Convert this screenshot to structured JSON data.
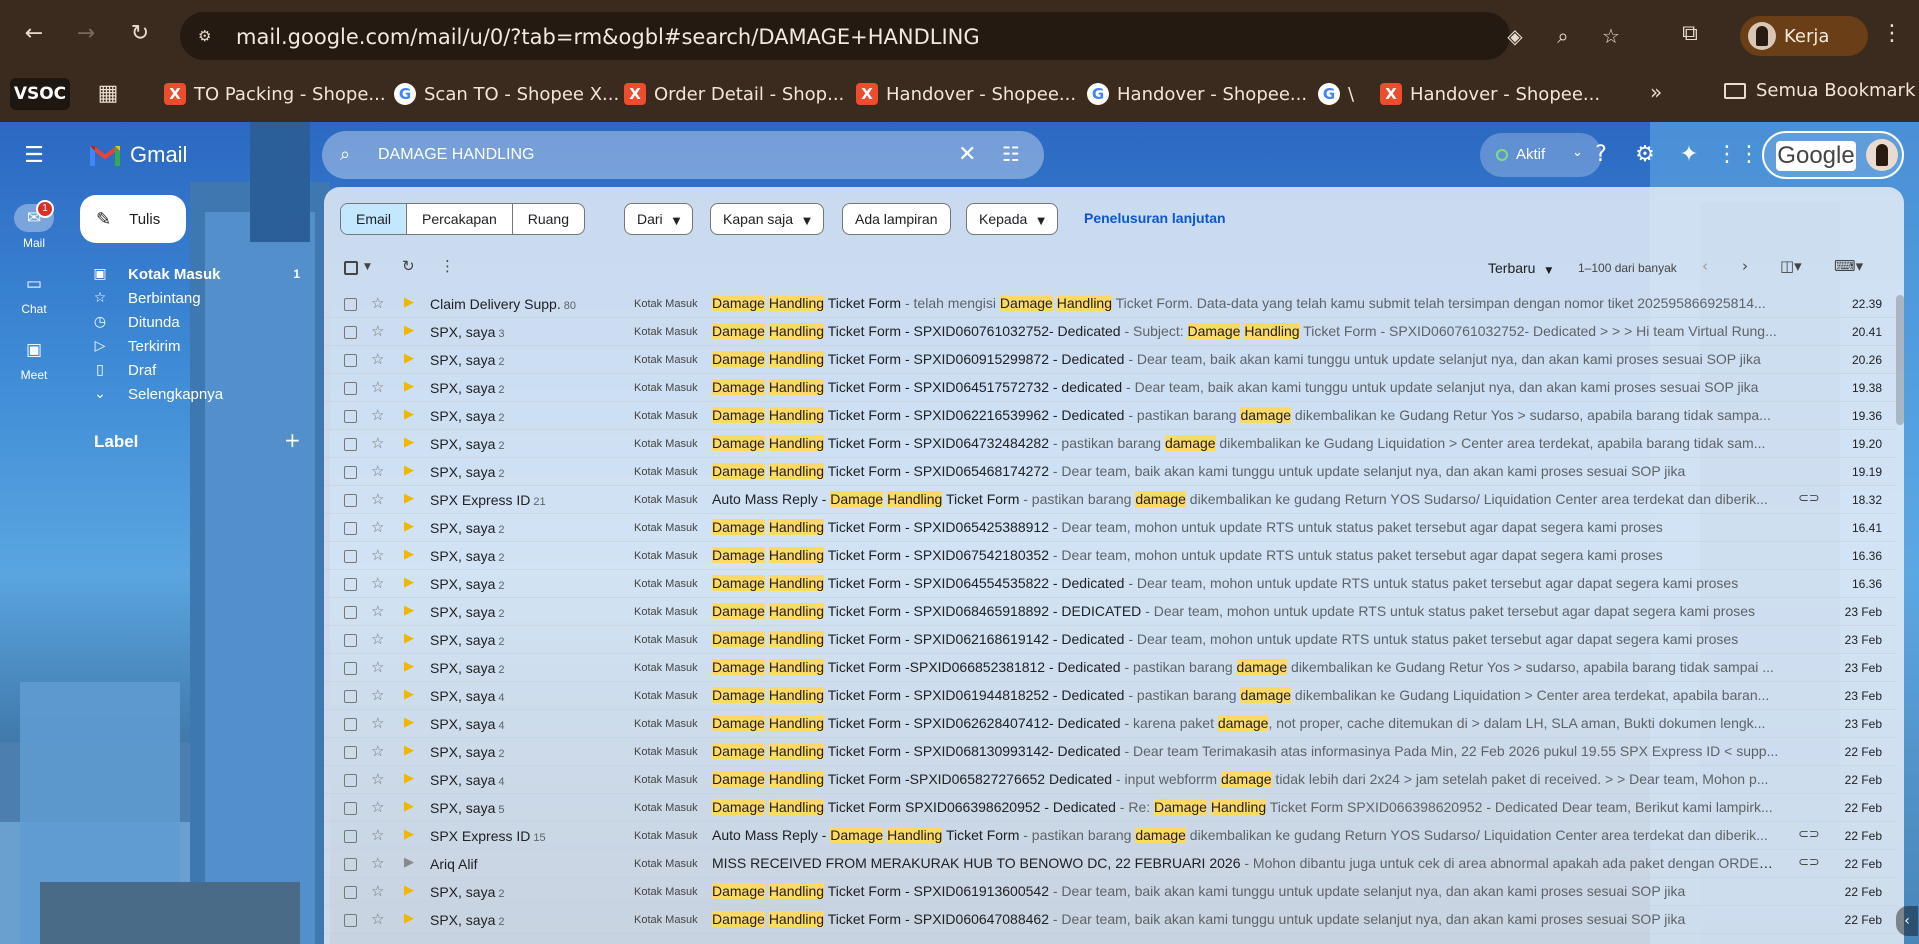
{
  "browser": {
    "url": "mail.google.com/mail/u/0/?tab=rm&ogbl#search/DAMAGE+HANDLING",
    "profile_name": "Kerja",
    "bookmarks": [
      {
        "label": "TO Packing - Shope...",
        "icon": "x"
      },
      {
        "label": "Scan TO - Shopee X...",
        "icon": "g"
      },
      {
        "label": "Order Detail - Shop...",
        "icon": "x"
      },
      {
        "label": "Handover - Shopee...",
        "icon": "x"
      },
      {
        "label": "Handover - Shopee...",
        "icon": "g"
      },
      {
        "label": "\\",
        "icon": "g"
      },
      {
        "label": "Handover - Shopee...",
        "icon": "x"
      }
    ],
    "vsoc_label": "VSOC",
    "bookmarks_folder": "Semua Bookmark"
  },
  "gmail": {
    "logo_text": "Gmail",
    "search_value": "DAMAGE HANDLING",
    "status_label": "Aktif",
    "account_logo_text": "Google",
    "rail": {
      "mail": "Mail",
      "mail_badge": "1",
      "chat": "Chat",
      "meet": "Meet"
    },
    "compose_label": "Tulis",
    "nav": [
      {
        "label": "Kotak Masuk",
        "count": "1",
        "icon": "inbox-icon"
      },
      {
        "label": "Berbintang",
        "count": "",
        "icon": "star-icon"
      },
      {
        "label": "Ditunda",
        "count": "",
        "icon": "clock-icon"
      },
      {
        "label": "Terkirim",
        "count": "",
        "icon": "send-icon"
      },
      {
        "label": "Draf",
        "count": "",
        "icon": "draft-icon"
      },
      {
        "label": "Selengkapnya",
        "count": "",
        "icon": "chevron-down-icon"
      }
    ],
    "labels_heading": "Label",
    "scope_tabs": [
      "Email",
      "Percakapan",
      "Ruang"
    ],
    "filters": {
      "from": "Dari",
      "time": "Kapan saja",
      "attachment": "Ada lampiran",
      "to": "Kepada",
      "advanced": "Penelusuran lanjutan"
    },
    "sort_label": "Terbaru",
    "range_text": "1–100 dari banyak",
    "inbox_tag": "Kotak Masuk",
    "emails": [
      {
        "sender": "Claim Delivery Supp.",
        "count": "80",
        "important": true,
        "subject_parts": [
          [
            "Damage",
            1
          ],
          [
            " ",
            0
          ],
          [
            "Handling",
            1
          ],
          [
            " Ticket Form",
            0
          ]
        ],
        "snippet_parts": [
          [
            " - telah mengisi ",
            0
          ],
          [
            "Damage",
            1
          ],
          [
            " ",
            0
          ],
          [
            "Handling",
            1
          ],
          [
            " Ticket Form. Data-data yang telah kamu submit telah tersimpan dengan nomor tiket 202595866925814...",
            0
          ]
        ],
        "attachment": false,
        "date": "22.39"
      },
      {
        "sender": "SPX, saya",
        "count": "3",
        "important": true,
        "subject_parts": [
          [
            "Damage",
            1
          ],
          [
            " ",
            0
          ],
          [
            "Handling",
            1
          ],
          [
            " Ticket Form - SPXID060761032752- Dedicated",
            0
          ]
        ],
        "snippet_parts": [
          [
            " - Subject: ",
            0
          ],
          [
            "Damage",
            1
          ],
          [
            " ",
            0
          ],
          [
            "Handling",
            1
          ],
          [
            " Ticket Form - SPXID060761032752- Dedicated > > > Hi team Virtual Rung...",
            0
          ]
        ],
        "attachment": false,
        "date": "20.41"
      },
      {
        "sender": "SPX, saya",
        "count": "2",
        "important": true,
        "subject_parts": [
          [
            "Damage",
            1
          ],
          [
            " ",
            0
          ],
          [
            "Handling",
            1
          ],
          [
            " Ticket Form - SPXID060915299872 - Dedicated",
            0
          ]
        ],
        "snippet_parts": [
          [
            " - Dear team, baik akan kami tunggu untuk update selanjut nya, dan akan kami proses sesuai SOP jika",
            0
          ]
        ],
        "attachment": false,
        "date": "20.26"
      },
      {
        "sender": "SPX, saya",
        "count": "2",
        "important": true,
        "subject_parts": [
          [
            "Damage",
            1
          ],
          [
            " ",
            0
          ],
          [
            "Handling",
            1
          ],
          [
            " Ticket Form - SPXID064517572732 - dedicated",
            0
          ]
        ],
        "snippet_parts": [
          [
            " - Dear team, baik akan kami tunggu untuk update selanjut nya, dan akan kami proses sesuai SOP jika",
            0
          ]
        ],
        "attachment": false,
        "date": "19.38"
      },
      {
        "sender": "SPX, saya",
        "count": "2",
        "important": true,
        "subject_parts": [
          [
            "Damage",
            1
          ],
          [
            " ",
            0
          ],
          [
            "Handling",
            1
          ],
          [
            " Ticket Form - SPXID062216539962 - Dedicated",
            0
          ]
        ],
        "snippet_parts": [
          [
            " - pastikan barang ",
            0
          ],
          [
            "damage",
            1
          ],
          [
            " dikembalikan ke Gudang Retur Yos > sudarso, apabila barang tidak sampa...",
            0
          ]
        ],
        "attachment": false,
        "date": "19.36"
      },
      {
        "sender": "SPX, saya",
        "count": "2",
        "important": true,
        "subject_parts": [
          [
            "Damage",
            1
          ],
          [
            " ",
            0
          ],
          [
            "Handling",
            1
          ],
          [
            " Ticket Form - SPXID064732484282",
            0
          ]
        ],
        "snippet_parts": [
          [
            " - pastikan barang ",
            0
          ],
          [
            "damage",
            1
          ],
          [
            " dikembalikan ke Gudang Liquidation > Center area terdekat, apabila barang tidak sam...",
            0
          ]
        ],
        "attachment": false,
        "date": "19.20"
      },
      {
        "sender": "SPX, saya",
        "count": "2",
        "important": true,
        "subject_parts": [
          [
            "Damage",
            1
          ],
          [
            " ",
            0
          ],
          [
            "Handling",
            1
          ],
          [
            " Ticket Form - SPXID065468174272",
            0
          ]
        ],
        "snippet_parts": [
          [
            " - Dear team, baik akan kami tunggu untuk update selanjut nya, dan akan kami proses sesuai SOP jika",
            0
          ]
        ],
        "attachment": false,
        "date": "19.19"
      },
      {
        "sender": "SPX Express ID",
        "count": "21",
        "important": true,
        "subject_parts": [
          [
            "Auto Mass Reply - ",
            0
          ],
          [
            "Damage",
            1
          ],
          [
            " ",
            0
          ],
          [
            "Handling",
            1
          ],
          [
            " Ticket Form",
            0
          ]
        ],
        "snippet_parts": [
          [
            " - pastikan barang ",
            0
          ],
          [
            "damage",
            1
          ],
          [
            " dikembalikan ke gudang Return YOS Sudarso/ Liquidation Center area terdekat dan diberik...",
            0
          ]
        ],
        "attachment": true,
        "date": "18.32"
      },
      {
        "sender": "SPX, saya",
        "count": "2",
        "important": true,
        "subject_parts": [
          [
            "Damage",
            1
          ],
          [
            " ",
            0
          ],
          [
            "Handling",
            1
          ],
          [
            " Ticket Form - SPXID065425388912",
            0
          ]
        ],
        "snippet_parts": [
          [
            " - Dear team, mohon untuk update RTS untuk status paket tersebut agar dapat segera kami proses",
            0
          ]
        ],
        "attachment": false,
        "date": "16.41"
      },
      {
        "sender": "SPX, saya",
        "count": "2",
        "important": true,
        "subject_parts": [
          [
            "Damage",
            1
          ],
          [
            " ",
            0
          ],
          [
            "Handling",
            1
          ],
          [
            " Ticket Form - SPXID067542180352",
            0
          ]
        ],
        "snippet_parts": [
          [
            " - Dear team, mohon untuk update RTS untuk status paket tersebut agar dapat segera kami proses",
            0
          ]
        ],
        "attachment": false,
        "date": "16.36"
      },
      {
        "sender": "SPX, saya",
        "count": "2",
        "important": true,
        "subject_parts": [
          [
            "Damage",
            1
          ],
          [
            " ",
            0
          ],
          [
            "Handling",
            1
          ],
          [
            " Ticket Form - SPXID064554535822 - Dedicated",
            0
          ]
        ],
        "snippet_parts": [
          [
            " - Dear team, mohon untuk update RTS untuk status paket tersebut agar dapat segera kami proses",
            0
          ]
        ],
        "attachment": false,
        "date": "16.36"
      },
      {
        "sender": "SPX, saya",
        "count": "2",
        "important": true,
        "subject_parts": [
          [
            "Damage",
            1
          ],
          [
            " ",
            0
          ],
          [
            "Handling",
            1
          ],
          [
            " Ticket Form - SPXID068465918892 - DEDICATED",
            0
          ]
        ],
        "snippet_parts": [
          [
            " - Dear team, mohon untuk update RTS untuk status paket tersebut agar dapat segera kami proses",
            0
          ]
        ],
        "attachment": false,
        "date": "23 Feb"
      },
      {
        "sender": "SPX, saya",
        "count": "2",
        "important": true,
        "subject_parts": [
          [
            "Damage",
            1
          ],
          [
            " ",
            0
          ],
          [
            "Handling",
            1
          ],
          [
            " Ticket Form - SPXID062168619142 - Dedicated",
            0
          ]
        ],
        "snippet_parts": [
          [
            " - Dear team, mohon untuk update RTS untuk status paket tersebut agar dapat segera kami proses",
            0
          ]
        ],
        "attachment": false,
        "date": "23 Feb"
      },
      {
        "sender": "SPX, saya",
        "count": "2",
        "important": true,
        "subject_parts": [
          [
            "Damage",
            1
          ],
          [
            " ",
            0
          ],
          [
            "Handling",
            1
          ],
          [
            " Ticket Form -SPXID066852381812 - Dedicated",
            0
          ]
        ],
        "snippet_parts": [
          [
            " - pastikan barang ",
            0
          ],
          [
            "damage",
            1
          ],
          [
            " dikembalikan ke Gudang Retur Yos > sudarso, apabila barang tidak sampai ...",
            0
          ]
        ],
        "attachment": false,
        "date": "23 Feb"
      },
      {
        "sender": "SPX, saya",
        "count": "4",
        "important": true,
        "subject_parts": [
          [
            "Damage",
            1
          ],
          [
            " ",
            0
          ],
          [
            "Handling",
            1
          ],
          [
            " Ticket Form - SPXID061944818252 - Dedicated",
            0
          ]
        ],
        "snippet_parts": [
          [
            " - pastikan barang ",
            0
          ],
          [
            "damage",
            1
          ],
          [
            " dikembalikan ke Gudang Liquidation > Center area terdekat, apabila baran...",
            0
          ]
        ],
        "attachment": false,
        "date": "23 Feb"
      },
      {
        "sender": "SPX, saya",
        "count": "4",
        "important": true,
        "subject_parts": [
          [
            "Damage",
            1
          ],
          [
            " ",
            0
          ],
          [
            "Handling",
            1
          ],
          [
            " Ticket Form - SPXID062628407412- Dedicated",
            0
          ]
        ],
        "snippet_parts": [
          [
            " - karena paket ",
            0
          ],
          [
            "damage",
            1
          ],
          [
            ", not proper, cache ditemukan di > dalam LH, SLA aman, Bukti dokumen lengk...",
            0
          ]
        ],
        "attachment": false,
        "date": "23 Feb"
      },
      {
        "sender": "SPX, saya",
        "count": "2",
        "important": true,
        "subject_parts": [
          [
            "Damage",
            1
          ],
          [
            " ",
            0
          ],
          [
            "Handling",
            1
          ],
          [
            " Ticket Form - SPXID068130993142- Dedicated",
            0
          ]
        ],
        "snippet_parts": [
          [
            " - Dear team Terimakasih atas informasinya Pada Min, 22 Feb 2026 pukul 19.55 SPX Express ID < supp...",
            0
          ]
        ],
        "attachment": false,
        "date": "22 Feb"
      },
      {
        "sender": "SPX, saya",
        "count": "4",
        "important": true,
        "subject_parts": [
          [
            "Damage",
            1
          ],
          [
            " ",
            0
          ],
          [
            "Handling",
            1
          ],
          [
            " Ticket Form -SPXID065827276652 Dedicated",
            0
          ]
        ],
        "snippet_parts": [
          [
            " - input webforrm ",
            0
          ],
          [
            "damage",
            1
          ],
          [
            " tidak lebih dari 2x24 > jam setelah paket di received. > > Dear team, Mohon p...",
            0
          ]
        ],
        "attachment": false,
        "date": "22 Feb"
      },
      {
        "sender": "SPX, saya",
        "count": "5",
        "important": true,
        "subject_parts": [
          [
            "Damage",
            1
          ],
          [
            " ",
            0
          ],
          [
            "Handling",
            1
          ],
          [
            " Ticket Form SPXID066398620952 - Dedicated",
            0
          ]
        ],
        "snippet_parts": [
          [
            " - Re: ",
            0
          ],
          [
            "Damage",
            1
          ],
          [
            " ",
            0
          ],
          [
            "Handling",
            1
          ],
          [
            " Ticket Form SPXID066398620952 - Dedicated Dear team, Berikut kami lampirk...",
            0
          ]
        ],
        "attachment": false,
        "date": "22 Feb"
      },
      {
        "sender": "SPX Express ID",
        "count": "15",
        "important": true,
        "subject_parts": [
          [
            "Auto Mass Reply - ",
            0
          ],
          [
            "Damage",
            1
          ],
          [
            " ",
            0
          ],
          [
            "Handling",
            1
          ],
          [
            " Ticket Form",
            0
          ]
        ],
        "snippet_parts": [
          [
            " - pastikan barang ",
            0
          ],
          [
            "damage",
            1
          ],
          [
            " dikembalikan ke gudang Return YOS Sudarso/ Liquidation Center area terdekat dan diberik...",
            0
          ]
        ],
        "attachment": true,
        "date": "22 Feb"
      },
      {
        "sender": "Ariq Alif",
        "count": "",
        "important": false,
        "subject_parts": [
          [
            "MISS RECEIVED FROM MERAKURAK HUB TO BENOWO DC, 22 FEBRUARI 2026",
            0
          ]
        ],
        "snippet_parts": [
          [
            " - Mohon dibantu juga untuk cek di area abnormal apakah ada paket dengan ORDER ID t...",
            0
          ]
        ],
        "attachment": true,
        "date": "22 Feb"
      },
      {
        "sender": "SPX, saya",
        "count": "2",
        "important": true,
        "subject_parts": [
          [
            "Damage",
            1
          ],
          [
            " ",
            0
          ],
          [
            "Handling",
            1
          ],
          [
            " Ticket Form - SPXID061913600542",
            0
          ]
        ],
        "snippet_parts": [
          [
            " - Dear team, baik akan kami tunggu untuk update selanjut nya, dan akan kami proses sesuai SOP jika",
            0
          ]
        ],
        "attachment": false,
        "date": "22 Feb"
      },
      {
        "sender": "SPX, saya",
        "count": "2",
        "important": true,
        "subject_parts": [
          [
            "Damage",
            1
          ],
          [
            " ",
            0
          ],
          [
            "Handling",
            1
          ],
          [
            " Ticket Form - SPXID060647088462",
            0
          ]
        ],
        "snippet_parts": [
          [
            " - Dear team, baik akan kami tunggu untuk update selanjut nya, dan akan kami proses sesuai SOP jika",
            0
          ]
        ],
        "attachment": false,
        "date": "22 Feb"
      }
    ]
  }
}
